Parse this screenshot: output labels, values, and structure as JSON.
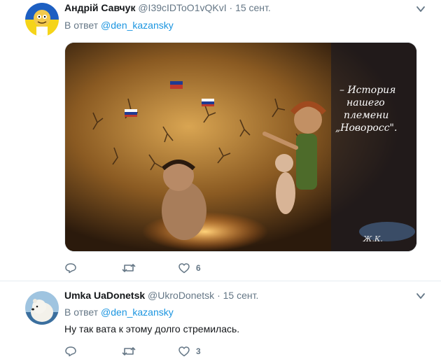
{
  "tweets": [
    {
      "author_name": "Андрій Савчук",
      "author_handle": "@I39cIDToO1vQKvI",
      "separator": "·",
      "timestamp": "15 сент.",
      "reply_prefix": "В ответ",
      "reply_to": "@den_kazansky",
      "text": "",
      "media": {
        "caption_lines": [
          "– История",
          "нашего",
          "племени",
          "„Новоросс\"."
        ],
        "signature": "Ж.К."
      },
      "reply_count": "",
      "retweet_count": "",
      "like_count": "6"
    },
    {
      "author_name": "Umka UaDonetsk",
      "author_handle": "@UkroDonetsk",
      "separator": "·",
      "timestamp": "15 сент.",
      "reply_prefix": "В ответ",
      "reply_to": "@den_kazansky",
      "text": "Ну так вата к этому долго стремилась.",
      "reply_count": "",
      "retweet_count": "",
      "like_count": "3"
    }
  ],
  "colors": {
    "link": "#1b95e0",
    "secondary_text": "#657786",
    "divider": "#e6ecf0"
  },
  "icons": [
    "reply-icon",
    "retweet-icon",
    "like-icon",
    "chevron-down-icon"
  ]
}
